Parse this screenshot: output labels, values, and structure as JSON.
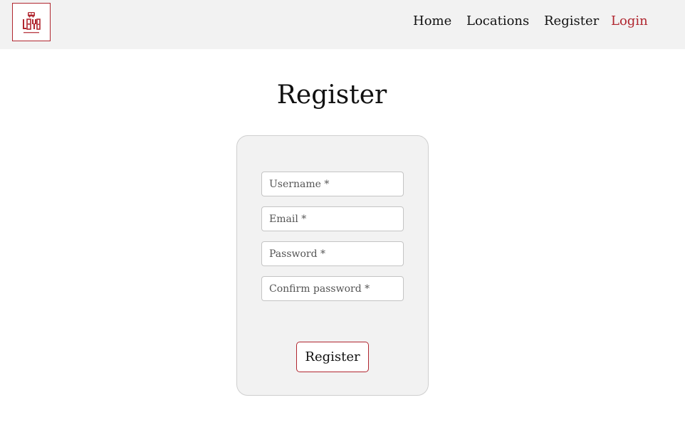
{
  "header": {
    "logo_text": "LAYBY",
    "logo_subtext": "CAR SPOT",
    "nav": {
      "home": "Home",
      "locations": "Locations",
      "register": "Register",
      "login": "Login"
    }
  },
  "main": {
    "title": "Register",
    "form": {
      "username_placeholder": "Username *",
      "email_placeholder": "Email *",
      "password_placeholder": "Password *",
      "confirm_password_placeholder": "Confirm password *",
      "submit_label": "Register"
    }
  },
  "colors": {
    "accent": "#b0262f",
    "navbar_bg": "#f2f2f2",
    "card_bg": "#f2f2f2"
  }
}
